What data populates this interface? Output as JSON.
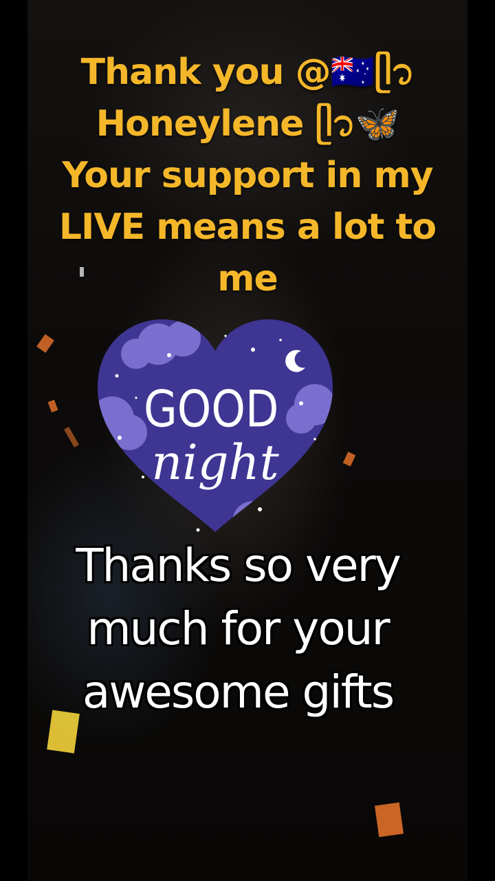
{
  "overlay": {
    "top_lines": [
      "Thank you @🇦🇺ᥫ᭡",
      "Honeylene ᥫ᭡🦋",
      "Your support in my",
      "LIVE means a lot to",
      "me"
    ],
    "bottom_lines": [
      "Thanks so very",
      "much for your",
      "awesome gifts"
    ]
  },
  "sticker": {
    "line1": "GOOD",
    "line2": "night",
    "heart_color": "#3f3592",
    "cloud_color": "#7a6fcf",
    "text_color": "#ffffff"
  },
  "colors": {
    "top_text": "#f5b72a",
    "bottom_text": "#ffffff",
    "confetti": "#e0702a"
  }
}
